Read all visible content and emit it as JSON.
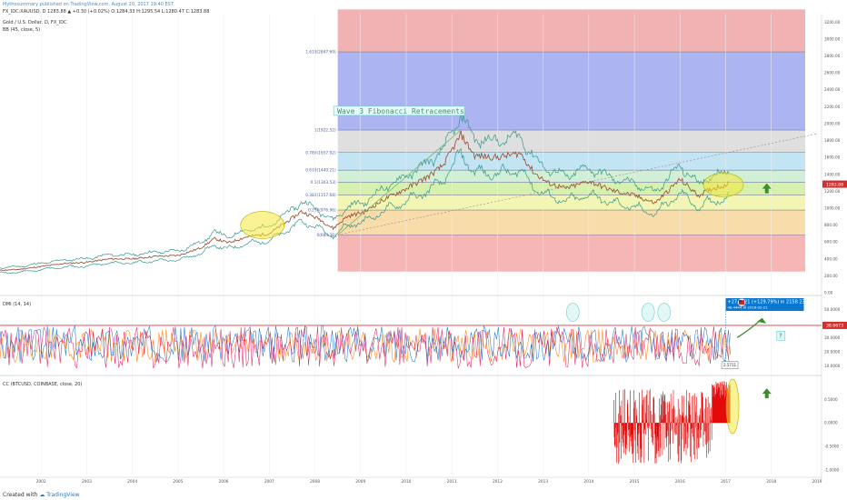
{
  "header": {
    "publisher": "Mythosummary published on TradingView.com, August 20, 2017 19:40 EST",
    "symbol_line": "FX_IDC:XAUUSD, D 1283.88 ▲ +0.30 (+0.02%) O:1284.33 H:1295.54 L:1280.47 C:1283.88",
    "title": "Gold / U.S. Dollar, D, FX_IDC",
    "bb_label": "BB (45, close, 5)"
  },
  "colors": {
    "price": "#9c5a3c",
    "bb": "#36988f",
    "dmi_plus": "#1f77d4",
    "dmi_minus": "#ff7f0e",
    "adx": "#e02863",
    "cc": "#e00000",
    "horizontal_line": "#e53935",
    "highlight": "#f4ea3a",
    "arrow": "#3a8f2b",
    "callout": "#0a78d1"
  },
  "annotations": {
    "wave_label": "Wave 3 Fibonacci Retracements",
    "measure_line1": "+27.3621 (+129.79%) in 2158 23h",
    "measure_line2": "48.4444 @ 2016-02-21",
    "question_mark": "?",
    "current_price_tag": "1283.88",
    "dmi_level_tag": "38.6673",
    "dmi_small_box": "2.5711"
  },
  "panes": {
    "dmi_label": "DMI (14, 14)",
    "cc_label": "CC (BTCUSD, COINBASE, close, 20)"
  },
  "footer": {
    "created_with": "Created with",
    "brand": "TradingView"
  },
  "icons": {
    "flag": "us-flag-icon",
    "arrow": "up-arrow-icon",
    "tv_logo": "tradingview-logo-icon"
  },
  "chart_data": [
    {
      "type": "line",
      "x_label_text": [
        "2002",
        "2003",
        "2004",
        "2005",
        "2006",
        "2007",
        "2008",
        "2009",
        "2010",
        "2011",
        "2012",
        "2013",
        "2014",
        "2015",
        "2016",
        "2017",
        "2018",
        "2019"
      ],
      "y_ticks": [
        "3200.00",
        "3000.00",
        "2800.00",
        "2600.00",
        "2400.00",
        "2200.00",
        "2000.00",
        "1800.00",
        "1600.00",
        "1400.00",
        "1200.00",
        "1000.00",
        "800.00",
        "600.00",
        "400.00",
        "200.00",
        "0.00"
      ],
      "ylim": [
        0,
        3300
      ],
      "xlim": [
        2001.6,
        2019.6
      ],
      "series": [
        {
          "x": [
            2001.6,
            2002,
            2002.5,
            2003,
            2003.5,
            2004,
            2004.5,
            2005,
            2005.5,
            2006,
            2006.3,
            2006.6,
            2007,
            2007.5,
            2008,
            2008.2,
            2008.6,
            2008.9,
            2009.2,
            2009.6,
            2010,
            2010.5,
            2011,
            2011.3,
            2011.7,
            2012,
            2012.5,
            2013,
            2013.3,
            2013.6,
            2014,
            2014.5,
            2015,
            2015.5,
            2015.95,
            2016.5,
            2016.9,
            2017.2,
            2017.6
          ],
          "values": [
            265,
            275,
            310,
            345,
            360,
            400,
            400,
            430,
            440,
            530,
            640,
            590,
            660,
            700,
            880,
            960,
            870,
            760,
            900,
            960,
            1100,
            1230,
            1380,
            1500,
            1870,
            1620,
            1600,
            1650,
            1420,
            1300,
            1230,
            1320,
            1210,
            1150,
            1060,
            1340,
            1150,
            1230,
            1290
          ]
        }
      ],
      "fibonacci_levels": [
        {
          "label": "1.618(2847.69)",
          "value": 2848
        },
        {
          "label": "1(1922.52)",
          "value": 1923
        },
        {
          "label": "0.786(1657.92)",
          "value": 1658
        },
        {
          "label": "0.618(1449.21)",
          "value": 1449
        },
        {
          "label": "0.5(1303.53)",
          "value": 1304
        },
        {
          "label": "0.382(1157.68)",
          "value": 1158
        },
        {
          "label": "0.236(976.96)",
          "value": 977
        },
        {
          "label": "0(684.36)",
          "value": 684
        }
      ],
      "fib_x_start": 2009.0,
      "fib_top": 3350
    },
    {
      "type": "line",
      "name_text": "DMI (14, 14)",
      "y_ticks": [
        "50.0000",
        "40.0000",
        "30.0000",
        "20.0000",
        "10.0000"
      ],
      "ylim": [
        5,
        58
      ],
      "horizontal_line": 38.6673
    },
    {
      "type": "bar",
      "name_text": "CC (BTCUSD, COINBASE, close, 20)",
      "y_ticks": [
        "0.5000",
        "0.0000",
        "-0.5000",
        "-1.0000"
      ],
      "ylim": [
        -1.1,
        0.95
      ],
      "x_start": 2015.05,
      "x_end": 2017.6
    }
  ]
}
